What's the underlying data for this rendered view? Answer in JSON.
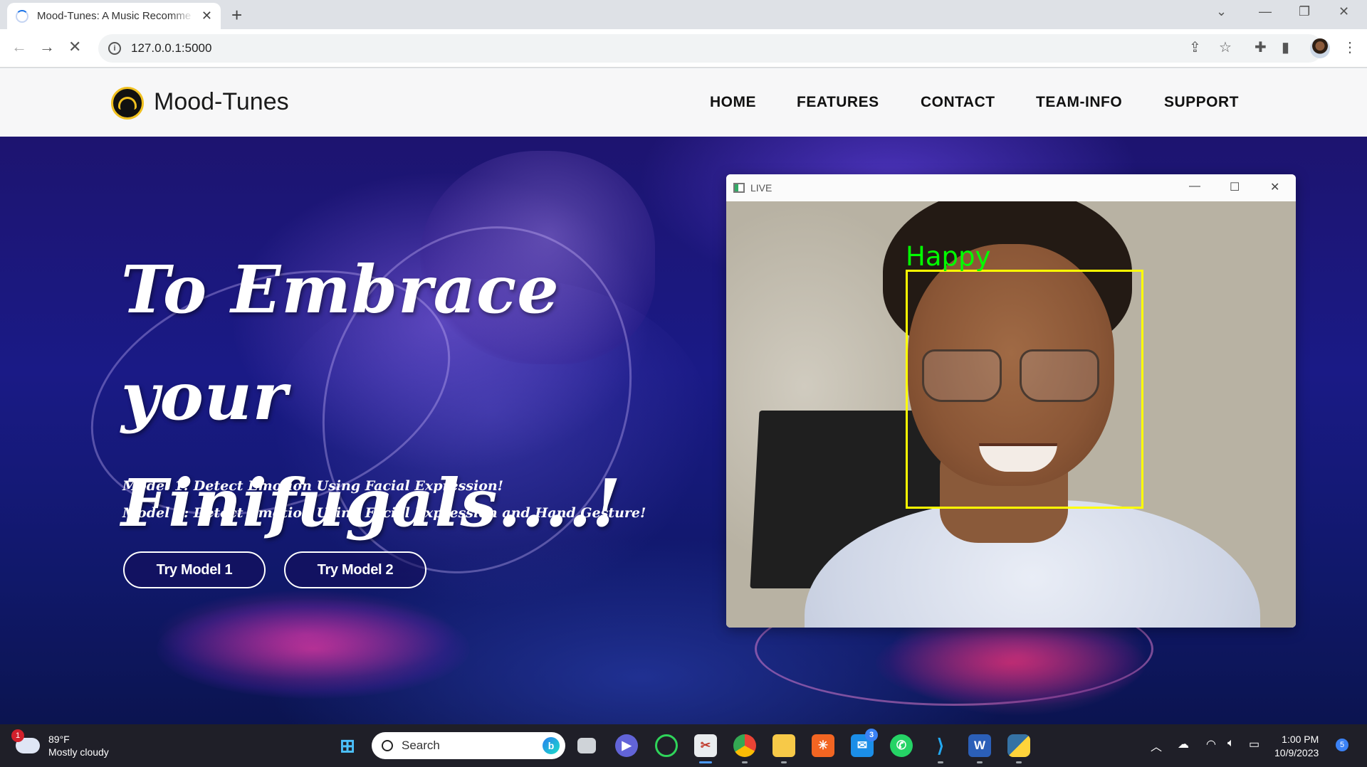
{
  "browser": {
    "tab_title": "Mood-Tunes: A Music Recomme",
    "url": "127.0.0.1:5000"
  },
  "site": {
    "brand": "Mood-Tunes",
    "nav": [
      "HOME",
      "FEATURES",
      "CONTACT",
      "TEAM-INFO",
      "SUPPORT"
    ]
  },
  "hero": {
    "headline_line1": "To Embrace your",
    "headline_line2": "Finifugals....!",
    "model1": "Model 1: Detect Emotion Using Facial Expression!",
    "model2": "Model 2: Detect Emotion Using Facial Expression and Hand Gesture!",
    "button1": "Try Model 1",
    "button2": "Try Model 2"
  },
  "live_window": {
    "title": "LIVE",
    "detected_emotion": "Happy",
    "box_color": "#ffff00",
    "label_color": "#00ff00"
  },
  "taskbar": {
    "weather_temp": "89°F",
    "weather_desc": "Mostly cloudy",
    "weather_badge": "1",
    "search_placeholder": "Search",
    "mail_badge": "3",
    "time": "1:00 PM",
    "date": "10/9/2023",
    "notification_count": "5"
  },
  "colors": {
    "accent": "#1a73e8",
    "hero_bg": "#1a1a86",
    "taskbar_bg": "#1f1f28"
  }
}
